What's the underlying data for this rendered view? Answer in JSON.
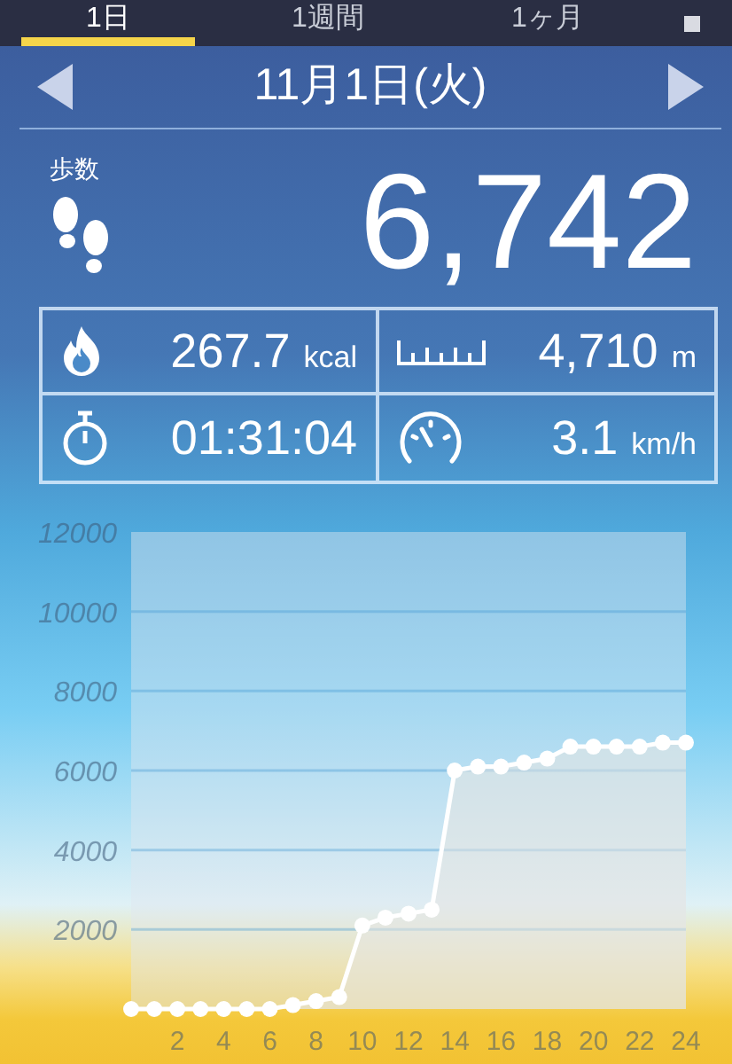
{
  "tabs": [
    {
      "label": "1日",
      "selected": true
    },
    {
      "label": "1週間",
      "selected": false
    },
    {
      "label": "1ヶ月",
      "selected": false
    }
  ],
  "date": "11月1日(火)",
  "steps": {
    "label": "歩数",
    "value": "6,742"
  },
  "stats": [
    {
      "kind": "calories",
      "value": "267.7",
      "unit": "kcal"
    },
    {
      "kind": "distance",
      "value": "4,710",
      "unit": "m"
    },
    {
      "kind": "time",
      "value": "01:31:04"
    },
    {
      "kind": "speed",
      "value": "3.1",
      "unit": "km/h"
    }
  ],
  "chart_data": {
    "type": "area",
    "x": [
      0,
      1,
      2,
      3,
      4,
      5,
      6,
      7,
      8,
      9,
      10,
      11,
      12,
      13,
      14,
      15,
      16,
      17,
      18,
      19,
      20,
      21,
      22,
      23,
      24
    ],
    "values": [
      0,
      0,
      0,
      0,
      0,
      0,
      0,
      100,
      200,
      300,
      2100,
      2300,
      2400,
      2500,
      6000,
      6100,
      6100,
      6200,
      6300,
      6600,
      6600,
      6600,
      6600,
      6700,
      6700
    ],
    "grid": true,
    "xlim": [
      0,
      24
    ],
    "ylim": [
      0,
      12000
    ],
    "xticks": [
      2,
      4,
      6,
      8,
      10,
      12,
      14,
      16,
      18,
      20,
      22,
      24
    ],
    "yticks": [
      2000,
      4000,
      6000,
      8000,
      10000,
      12000
    ]
  }
}
